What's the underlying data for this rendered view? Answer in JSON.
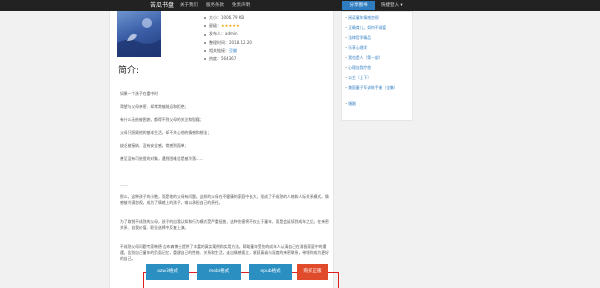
{
  "navbar": {
    "brand": "苦瓜书盘",
    "links": [
      "关于我们",
      "服务条款",
      "免责声明"
    ],
    "share": "分享图书",
    "login": "快捷登入 ▾"
  },
  "meta": [
    {
      "label": "大小：",
      "value": "1006.79 KB",
      "kind": "text"
    },
    {
      "label": "星级：",
      "value": "★★★★★",
      "kind": "stars"
    },
    {
      "label": "发布人：",
      "value": "admin",
      "kind": "text"
    },
    {
      "label": "整理时间：",
      "value": "2018.12.20",
      "kind": "text"
    },
    {
      "label": "相关链接：",
      "value": "豆瓣",
      "kind": "link"
    },
    {
      "label": "热度：",
      "value": "564367",
      "kind": "text"
    }
  ],
  "section_title": "简介:",
  "intro_lines": [
    "如果一个孩子在重中时",
    "渴望与父母亲密、却常常被疏远和拒绝；",
    "有什么无依被困惑，都得不到父母的关注和慰藉；",
    "父母只照顾他的基本生活，却不关心他的情感和想法；",
    "缺乏被接纳、没有安全感，常感到孤单；",
    "甚至没有可依靠的对象，遇到困难总是被冷落……"
  ],
  "divider": "——",
  "body_paras": [
    "那么，这种孩子的小胞，而是他的父母有问题。这样的父母在不健康的家庭中长大，形成了不成熟的人格和人际关系模式。情感被冷漠忽视，成为了情绪上的孩子，难以承担自己的责任。",
    "为了取悦不成熟的父母，孩子的自我认知和行为模式受严重扭曲，这种伤害将不仅止于童年，而是会延续到成年之后，在亲密关系、自我价值、职业选择中反复上演。",
    "不成熟父母问题专家韩德·吉布森博士提供了丰富的真实案例和实用方法，帮助童年受伤的成年人认清自己在消极家庭中的遭遇，告别自己童年的负面记忆，重建自己的性格、关系和生活，走出情感孤立，收获真诚与深度的亲密联系，带领你成为更好的自己。"
  ],
  "buttons": {
    "azw3": "azw3格式",
    "mobi": "mobi格式",
    "epub": "epub格式",
    "buy": "购买正版"
  },
  "sidebar": [
    "阅读童年情感忽视",
    "正确育儿，如何不溺爱",
    "法律哲学精品",
    "乐享心理学",
    "我也是人（第一部）",
    "心理自我疗愈",
    "公主（上下）",
    "美国童子军训练手册（全集）",
    "婚姻"
  ],
  "colors": {
    "navbar": "#222222",
    "accent": "#2f7dc1",
    "download": "#2b8fc2",
    "buy": "#e04b2c",
    "highlight": "#e02020"
  }
}
